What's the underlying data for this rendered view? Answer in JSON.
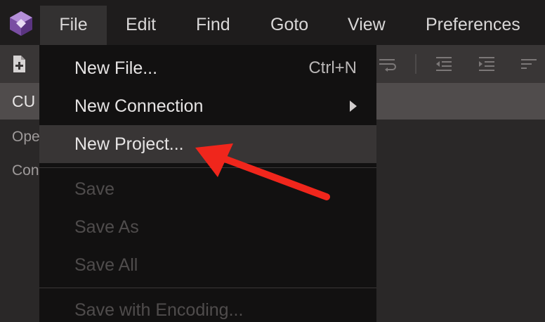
{
  "menubar": {
    "items": [
      {
        "label": "File"
      },
      {
        "label": "Edit"
      },
      {
        "label": "Find"
      },
      {
        "label": "Goto"
      },
      {
        "label": "View"
      },
      {
        "label": "Preferences"
      }
    ]
  },
  "panel": {
    "header_title": "CU",
    "rows": [
      {
        "label": "Ope"
      },
      {
        "label": "Con"
      }
    ]
  },
  "file_menu": {
    "new_file": {
      "label": "New File...",
      "shortcut": "Ctrl+N"
    },
    "new_connection": {
      "label": "New Connection"
    },
    "new_project": {
      "label": "New Project..."
    },
    "save": {
      "label": "Save"
    },
    "save_as": {
      "label": "Save As"
    },
    "save_all": {
      "label": "Save All"
    },
    "save_with_encoding": {
      "label": "Save with Encoding..."
    }
  },
  "colors": {
    "menubar_bg": "#1e1c1c",
    "dropdown_bg": "#121111",
    "hover_bg": "#383535",
    "annotation_arrow": "#f0261c",
    "logo_purple": "#8a5fb0"
  },
  "icons": [
    "app-logo-icon",
    "new-file-icon",
    "word-wrap-icon",
    "outdent-icon",
    "indent-icon",
    "sort-icon",
    "submenu-arrow-icon"
  ]
}
